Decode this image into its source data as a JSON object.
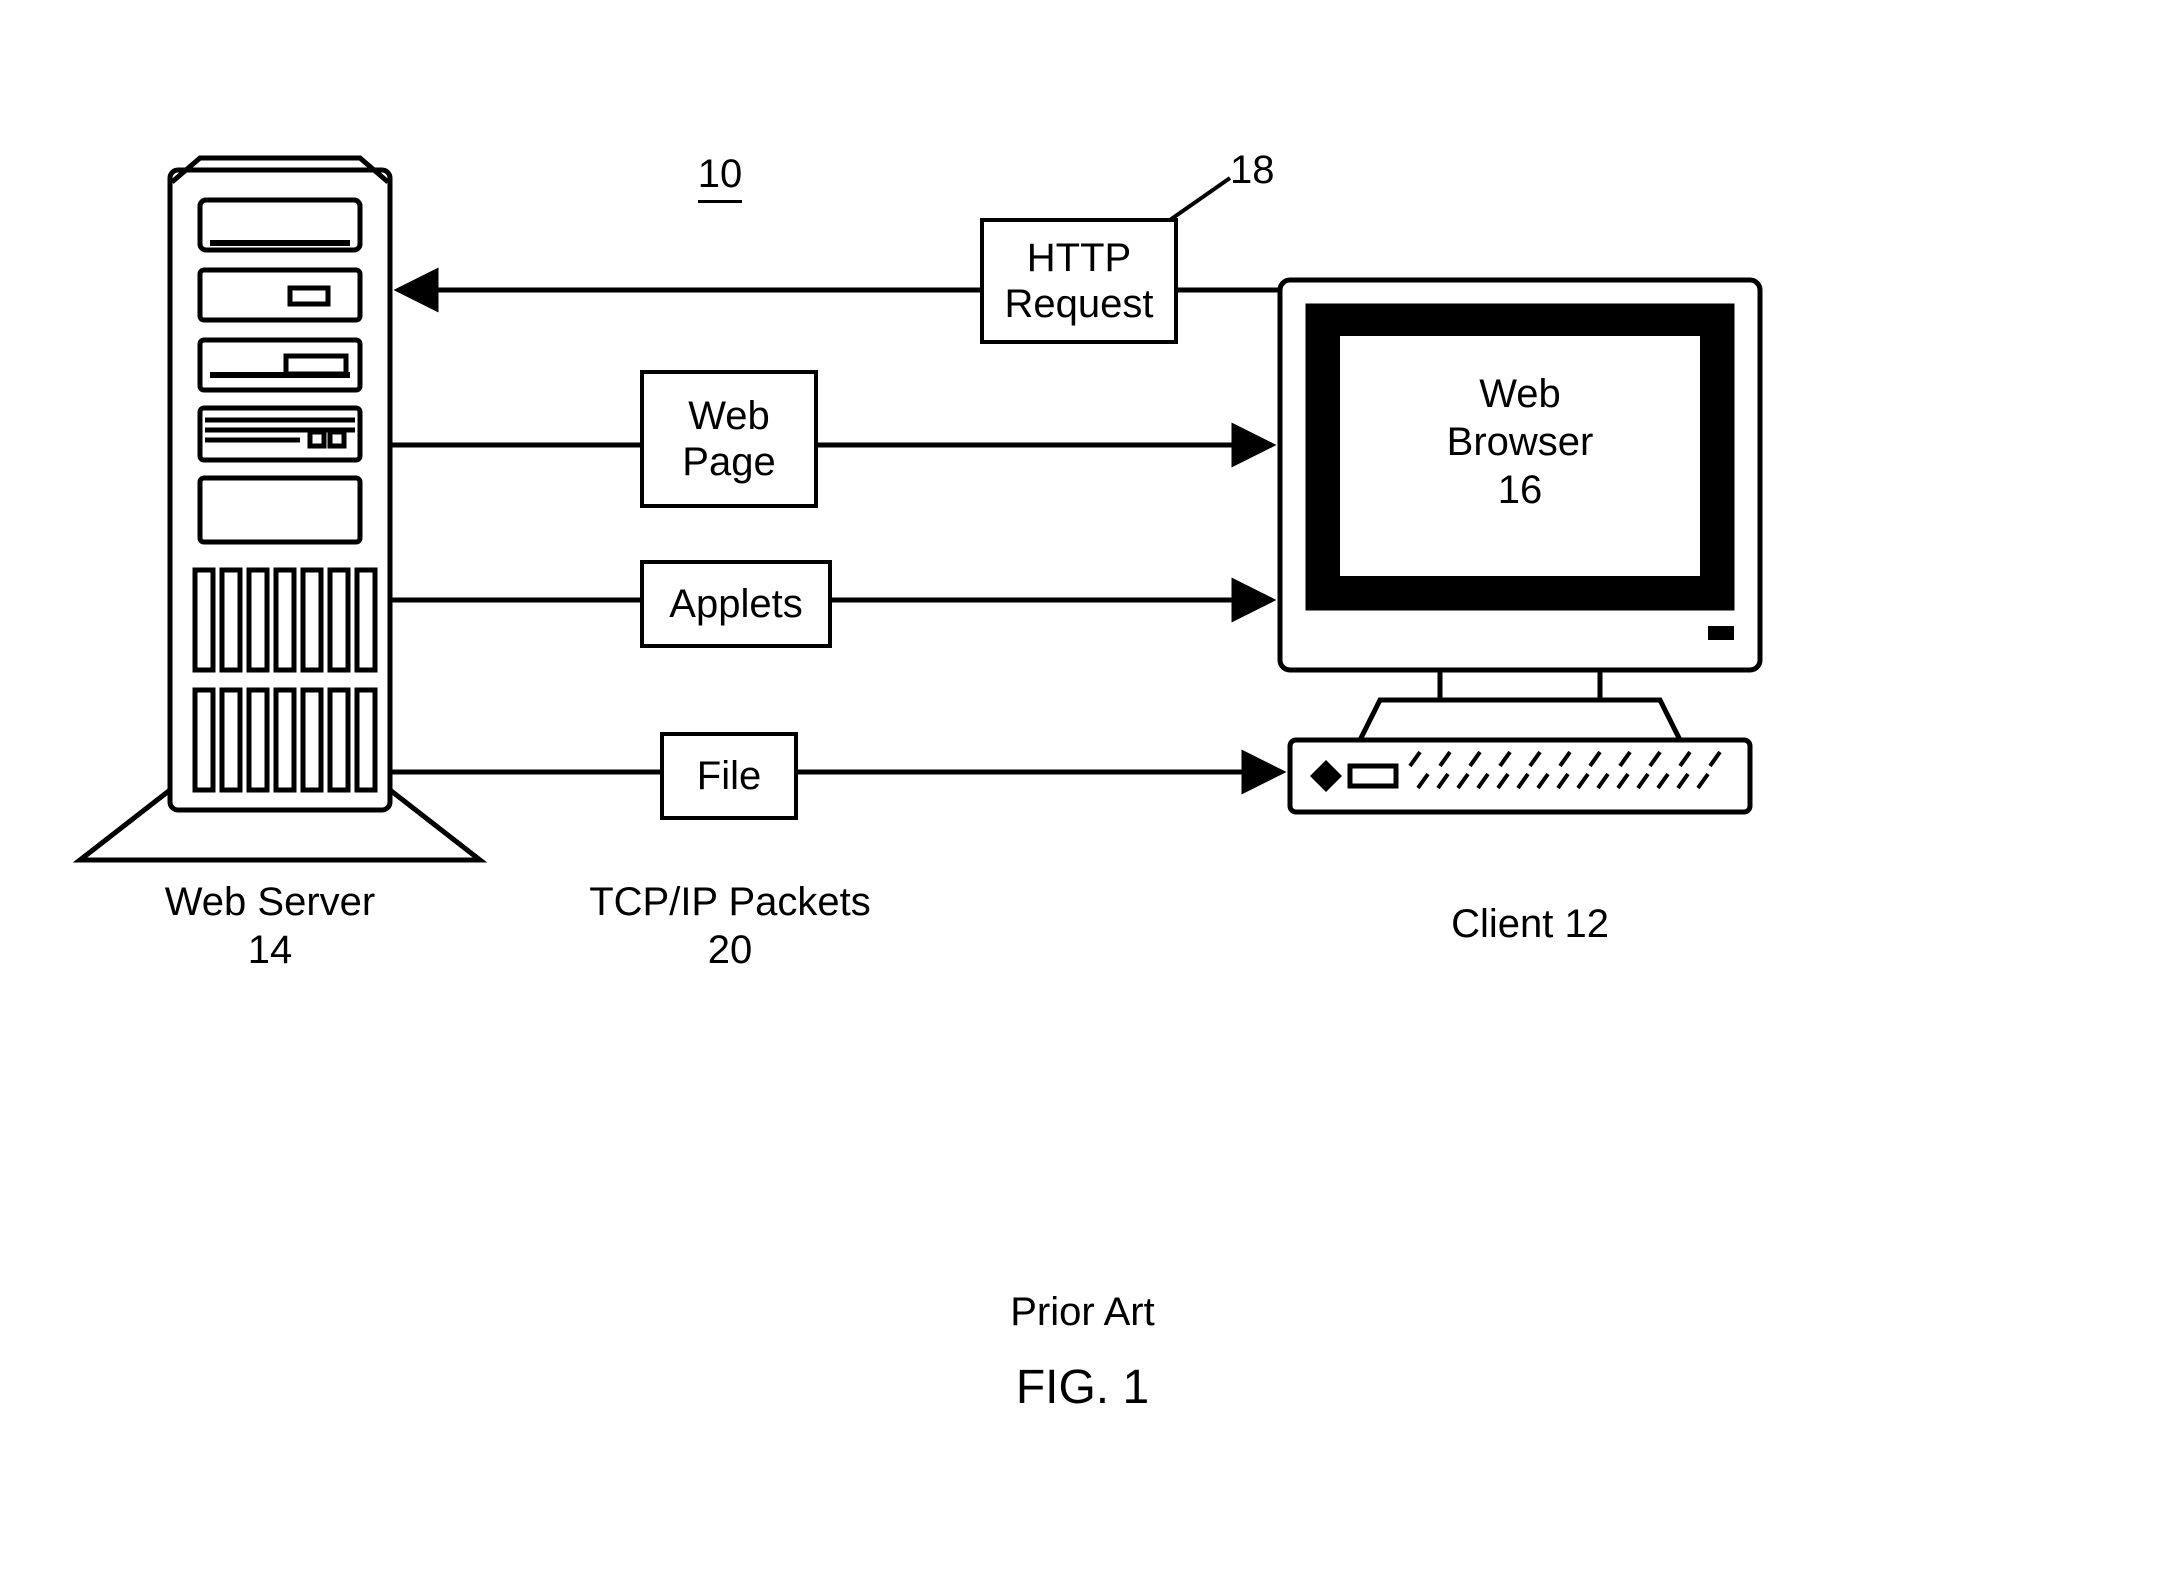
{
  "figure": {
    "number_ref": "10",
    "caption_priorart": "Prior Art",
    "caption_fig": "FIG. 1"
  },
  "server": {
    "label": "Web Server",
    "ref": "14"
  },
  "client": {
    "label": "Client 12",
    "browser_line1": "Web",
    "browser_line2": "Browser",
    "browser_ref": "16"
  },
  "packets": {
    "label": "TCP/IP Packets",
    "ref": "20"
  },
  "http": {
    "line1": "HTTP",
    "line2": "Request",
    "ref": "18"
  },
  "boxes": {
    "webpage_l1": "Web",
    "webpage_l2": "Page",
    "applets": "Applets",
    "file": "File"
  }
}
